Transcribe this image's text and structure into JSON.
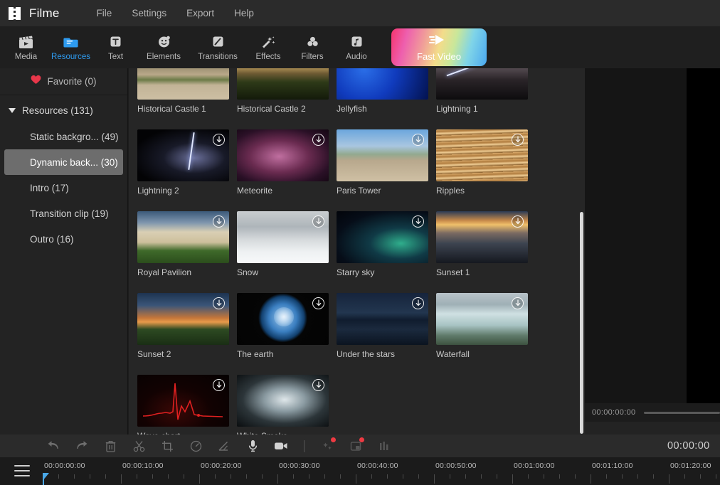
{
  "titlebar": {
    "app_title": "Filme",
    "logo_icon": "film-strip-icon",
    "menu": [
      {
        "label": "File",
        "name": "menu-file"
      },
      {
        "label": "Settings",
        "name": "menu-settings"
      },
      {
        "label": "Export",
        "name": "menu-export"
      },
      {
        "label": "Help",
        "name": "menu-help"
      }
    ]
  },
  "toolbar": {
    "active": "Resources",
    "items": [
      {
        "label": "Media",
        "icon": "clapperboard-icon"
      },
      {
        "label": "Resources",
        "icon": "folder-icon"
      },
      {
        "label": "Text",
        "icon": "text-box-icon"
      },
      {
        "label": "Elements",
        "icon": "smiley-icon"
      },
      {
        "label": "Transitions",
        "icon": "transition-icon"
      },
      {
        "label": "Effects",
        "icon": "magic-wand-icon"
      },
      {
        "label": "Filters",
        "icon": "color-circles-icon"
      },
      {
        "label": "Audio",
        "icon": "music-note-icon"
      }
    ],
    "fast_video": {
      "label": "Fast Video",
      "icon": "fast-forward-icon"
    },
    "accent_color": "#2e9bf0"
  },
  "sidebar": {
    "favorite": {
      "label": "Favorite (0)",
      "icon": "heart-icon",
      "color": "#e8374a"
    },
    "resources": {
      "label": "Resources (131)",
      "icon": "caret-down-icon"
    },
    "categories": [
      {
        "label": "Static backgro... (49)",
        "selected": false
      },
      {
        "label": "Dynamic back... (30)",
        "selected": true
      },
      {
        "label": "Intro (17)",
        "selected": false
      },
      {
        "label": "Transition clip (19)",
        "selected": false
      },
      {
        "label": "Outro (16)",
        "selected": false
      }
    ]
  },
  "grid": {
    "download_icon": "download-circle-icon",
    "items": [
      {
        "caption": "Historical Castle 1",
        "art": "castle1"
      },
      {
        "caption": "Historical Castle 2",
        "art": "castle2"
      },
      {
        "caption": "Jellyfish",
        "art": "jellyfish"
      },
      {
        "caption": "Lightning 1",
        "art": "lightning1"
      },
      {
        "caption": "Lightning 2",
        "art": "lightning2"
      },
      {
        "caption": "Meteorite",
        "art": "meteorite"
      },
      {
        "caption": "Paris Tower",
        "art": "paris"
      },
      {
        "caption": "Ripples",
        "art": "ripples"
      },
      {
        "caption": "Royal Pavilion",
        "art": "pavilion"
      },
      {
        "caption": "Snow",
        "art": "snow"
      },
      {
        "caption": "Starry sky",
        "art": "starry"
      },
      {
        "caption": "Sunset 1",
        "art": "sunset1"
      },
      {
        "caption": "Sunset 2",
        "art": "sunset2"
      },
      {
        "caption": "The earth",
        "art": "earth"
      },
      {
        "caption": "Under the stars",
        "art": "understars"
      },
      {
        "caption": "Waterfall",
        "art": "waterfall"
      },
      {
        "caption": "Wave chart",
        "art": "wavechart"
      },
      {
        "caption": "White Smoke",
        "art": "smoke"
      }
    ]
  },
  "preview": {
    "timecode": "00:00:00:00"
  },
  "edit_bar": {
    "timecode": "00:00:00",
    "buttons": [
      {
        "name": "undo-button",
        "icon": "undo-icon",
        "badge": false
      },
      {
        "name": "redo-button",
        "icon": "redo-icon",
        "badge": false
      },
      {
        "name": "delete-button",
        "icon": "trash-icon",
        "badge": false
      },
      {
        "name": "split-button",
        "icon": "scissors-icon",
        "badge": false
      },
      {
        "name": "crop-button",
        "icon": "crop-icon",
        "badge": false
      },
      {
        "name": "speed-button",
        "icon": "speedometer-icon",
        "badge": false
      },
      {
        "name": "color-button",
        "icon": "color-adjust-icon",
        "badge": false
      },
      {
        "name": "voiceover-button",
        "icon": "microphone-icon",
        "badge": false
      },
      {
        "name": "record-screen-button",
        "icon": "video-camera-icon",
        "badge": false
      }
    ],
    "buttons_right": [
      {
        "name": "effects-quick-button",
        "icon": "sparkle-icon",
        "badge": true
      },
      {
        "name": "pip-button",
        "icon": "picture-in-picture-icon",
        "badge": true
      },
      {
        "name": "audio-mix-button",
        "icon": "equalizer-icon",
        "badge": false
      }
    ],
    "badge_color": "#ee3a42"
  },
  "timeline": {
    "menu_icon": "hamburger-menu-icon",
    "playhead_position": "00:00:00:00",
    "playhead_color": "#4aa8e8",
    "ticks": [
      "00:00:00:00",
      "00:00:10:00",
      "00:00:20:00",
      "00:00:30:00",
      "00:00:40:00",
      "00:00:50:00",
      "00:01:00:00",
      "00:01:10:00",
      "00:01:20:00"
    ]
  }
}
